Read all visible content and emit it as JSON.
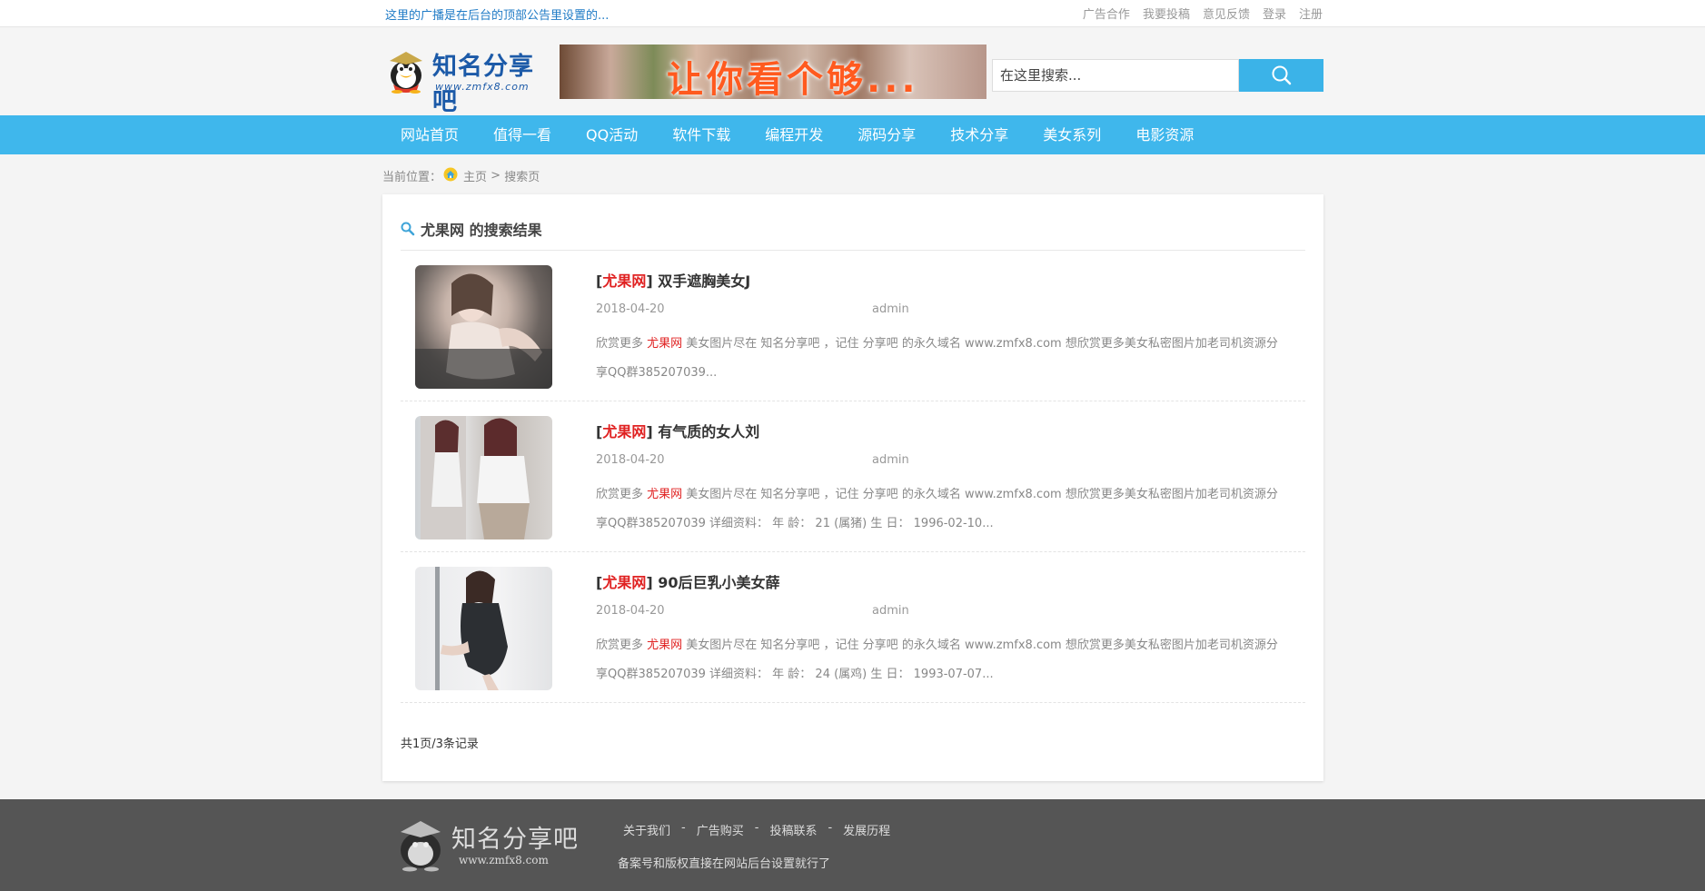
{
  "topbar": {
    "notice": "这里的广播是在后台的顶部公告里设置的...",
    "links": [
      "广告合作",
      "我要投稿",
      "意见反馈",
      "登录",
      "注册"
    ]
  },
  "header": {
    "logo_text": "知名分享吧",
    "logo_url": "www.zmfx8.com",
    "banner_text": "让你看个够..."
  },
  "search": {
    "placeholder": "在这里搜索..."
  },
  "nav": {
    "items": [
      "网站首页",
      "值得一看",
      "QQ活动",
      "软件下载",
      "编程开发",
      "源码分享",
      "技术分享",
      "美女系列",
      "电影资源"
    ]
  },
  "breadcrumb": {
    "prefix": "当前位置：",
    "home": "主页",
    "sep": " > ",
    "current": "搜索页"
  },
  "results": {
    "keyword": "尤果网",
    "title_suffix": " 的搜索结果",
    "items": [
      {
        "title": "双手遮胸美女J",
        "date": "2018-04-20",
        "author": "admin",
        "desc_pre": "欣赏更多 ",
        "desc_post": " 美女图片尽在 知名分享吧 ，记住 分享吧 的永久域名 www.zmfx8.com 想欣赏更多美女私密图片加老司机资源分享QQ群385207039..."
      },
      {
        "title": "有气质的女人刘",
        "date": "2018-04-20",
        "author": "admin",
        "desc_pre": "欣赏更多 ",
        "desc_post": " 美女图片尽在 知名分享吧 ，记住 分享吧 的永久域名 www.zmfx8.com 想欣赏更多美女私密图片加老司机资源分享QQ群385207039 详细资料： 年 龄： 21 (属猪) 生 日： 1996-02-10..."
      },
      {
        "title": "90后巨乳小美女薛",
        "date": "2018-04-20",
        "author": "admin",
        "desc_pre": "欣赏更多 ",
        "desc_post": " 美女图片尽在 知名分享吧 ，记住 分享吧 的永久域名 www.zmfx8.com 想欣赏更多美女私密图片加老司机资源分享QQ群385207039 详细资料： 年 龄： 24 (属鸡) 生 日： 1993-07-07..."
      }
    ],
    "pager": "共1页/3条记录"
  },
  "footer": {
    "logo_text": "知名分享吧",
    "logo_url": "www.zmfx8.com",
    "links": [
      "关于我们",
      "广告购买",
      "投稿联系",
      "发展历程"
    ],
    "separator": "-",
    "copyright": "备案号和版权直接在网站后台设置就行了"
  },
  "colors": {
    "accent": "#3fb7ec",
    "keyword": "#e02222",
    "footer_bg": "#555555"
  }
}
